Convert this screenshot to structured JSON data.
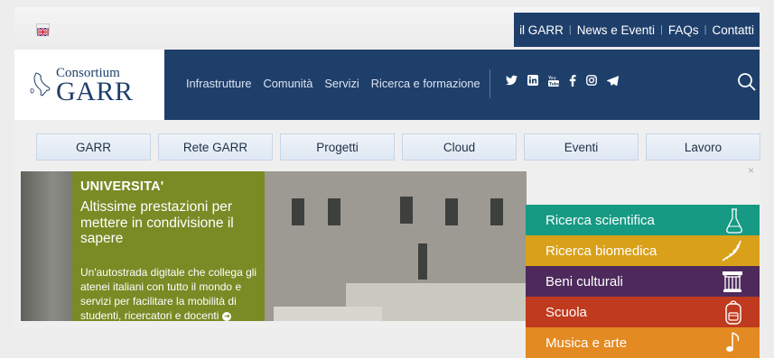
{
  "utility_nav": [
    "il GARR",
    "News e Eventi",
    "FAQs",
    "Contatti"
  ],
  "logo": {
    "line1": "Consortium",
    "line2": "GARR"
  },
  "main_nav": [
    "Infrastrutture",
    "Comunità",
    "Servizi",
    "Ricerca e formazione"
  ],
  "social_icons": [
    "twitter-icon",
    "linkedin-icon",
    "youtube-icon",
    "facebook-icon",
    "instagram-icon",
    "telegram-icon"
  ],
  "sections": [
    "GARR",
    "Rete GARR",
    "Progetti",
    "Cloud",
    "Eventi",
    "Lavoro"
  ],
  "close_symbol": "×",
  "hero": {
    "kicker": "UNIVERSITA'",
    "headline": "Altissime prestazioni per mettere in condivisione il sapere",
    "body": "Un'autostrada digitale che collega gli atenei italiani con tutto il mondo e servizi per facilitare la mobilità di studenti, ricercatori e docenti",
    "arrow": "➜"
  },
  "side_menu": [
    {
      "label": "Ricerca scientifica",
      "color": "#169a83",
      "icon": "flask-icon"
    },
    {
      "label": "Ricerca biomedica",
      "color": "#d9a11a",
      "icon": "dna-icon"
    },
    {
      "label": "Beni culturali",
      "color": "#4e2a5c",
      "icon": "column-icon"
    },
    {
      "label": "Scuola",
      "color": "#c03a1f",
      "icon": "backpack-icon"
    },
    {
      "label": "Musica e arte",
      "color": "#e38a22",
      "icon": "music-icon"
    }
  ],
  "colors": {
    "primary": "#1f3f6b",
    "hero_overlay": "#7a8a25"
  }
}
